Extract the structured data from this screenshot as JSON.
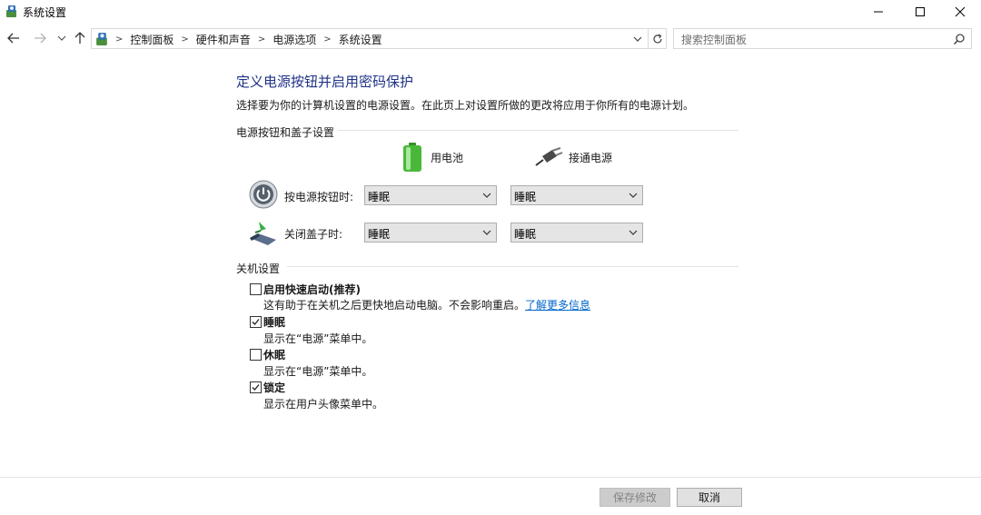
{
  "window": {
    "title": "系统设置",
    "icon": "control-panel-icon"
  },
  "address": {
    "crumbs": [
      "控制面板",
      "硬件和声音",
      "电源选项",
      "系统设置"
    ],
    "search_placeholder": "搜索控制面板"
  },
  "page": {
    "title": "定义电源按钮并启用密码保护",
    "description": "选择要为你的计算机设置的电源设置。在此页上对设置所做的更改将应用于你所有的电源计划。"
  },
  "power_section": {
    "heading": "电源按钮和盖子设置",
    "columns": [
      {
        "label": "用电池",
        "icon": "battery-icon"
      },
      {
        "label": "接通电源",
        "icon": "plug-icon"
      }
    ],
    "rows": [
      {
        "label": "按电源按钮时:",
        "icon": "power-button-icon",
        "battery": "睡眠",
        "plugged": "睡眠"
      },
      {
        "label": "关闭盖子时:",
        "icon": "laptop-lid-icon",
        "battery": "睡眠",
        "plugged": "睡眠"
      }
    ]
  },
  "shutdown_section": {
    "heading": "关机设置",
    "options": [
      {
        "label": "启用快速启动(推荐)",
        "checked": false,
        "desc": "这有助于在关机之后更快地启动电脑。不会影响重启。",
        "link": "了解更多信息"
      },
      {
        "label": "睡眠",
        "checked": true,
        "desc": "显示在“电源”菜单中。"
      },
      {
        "label": "休眠",
        "checked": false,
        "desc": "显示在“电源”菜单中。"
      },
      {
        "label": "锁定",
        "checked": true,
        "desc": "显示在用户头像菜单中。"
      }
    ]
  },
  "footer": {
    "save_label": "保存修改",
    "cancel_label": "取消"
  }
}
